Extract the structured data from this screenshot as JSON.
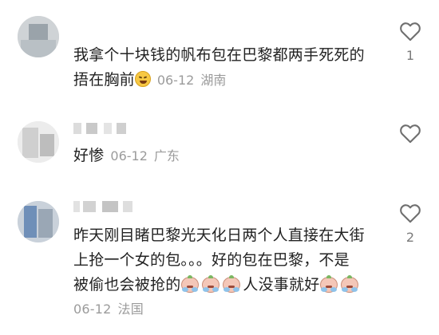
{
  "comments": [
    {
      "text_line1": "我拿个十块钱的帆布包在巴黎都两手死死的",
      "text_line2": "捂在胸前",
      "emoji": "rofl-face-icon",
      "date": "06-12",
      "location": "湖南",
      "likes": "1"
    },
    {
      "text": "好惨",
      "date": "06-12",
      "location": "广东",
      "likes": ""
    },
    {
      "text_line1": "昨天刚目睹巴黎光天化日两个人直接在大街",
      "text_line2": "上抢一个女的包。。。好的包在巴黎，不是",
      "text_line3a": "被偷也会被抢的",
      "text_line3b": "人没事就好",
      "emoji": "crying-emoji-icon",
      "date": "06-12",
      "location": "法国",
      "likes": "2"
    }
  ],
  "colors": {
    "text": "#222222",
    "meta": "#9b9b9b",
    "like_count": "#7a7a7a"
  },
  "icons": {
    "like": "heart-outline-icon"
  }
}
